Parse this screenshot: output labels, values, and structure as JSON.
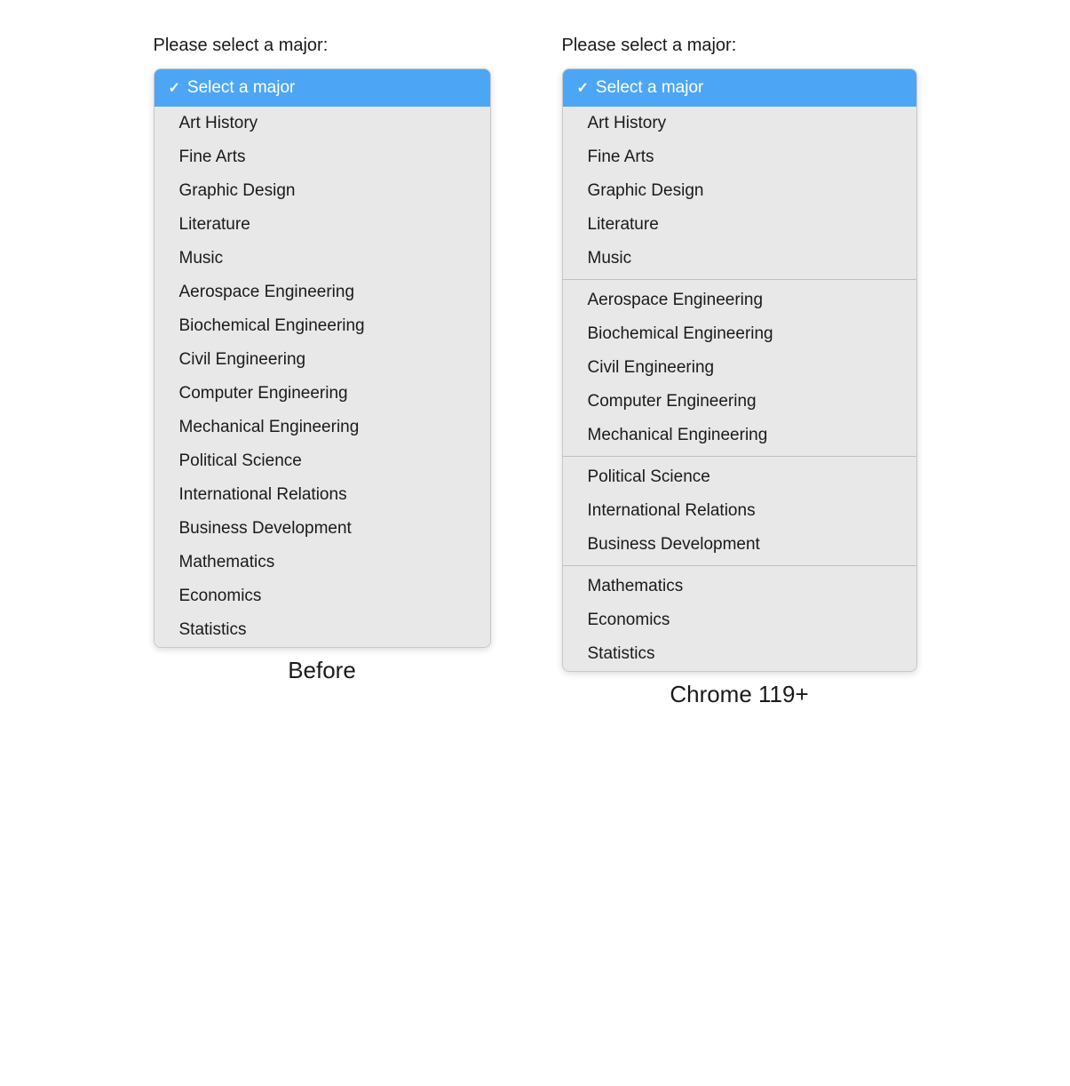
{
  "left": {
    "prompt": "Please select a major:",
    "caption": "Before",
    "selected_label": "Select a major",
    "options": [
      {
        "label": "Art History",
        "type": "option"
      },
      {
        "label": "Fine Arts",
        "type": "option"
      },
      {
        "label": "Graphic Design",
        "type": "option"
      },
      {
        "label": "Literature",
        "type": "option"
      },
      {
        "label": "Music",
        "type": "option"
      },
      {
        "label": "Aerospace Engineering",
        "type": "option"
      },
      {
        "label": "Biochemical Engineering",
        "type": "option"
      },
      {
        "label": "Civil Engineering",
        "type": "option"
      },
      {
        "label": "Computer Engineering",
        "type": "option"
      },
      {
        "label": "Mechanical Engineering",
        "type": "option"
      },
      {
        "label": "Political Science",
        "type": "option"
      },
      {
        "label": "International Relations",
        "type": "option"
      },
      {
        "label": "Business Development",
        "type": "option"
      },
      {
        "label": "Mathematics",
        "type": "option"
      },
      {
        "label": "Economics",
        "type": "option"
      },
      {
        "label": "Statistics",
        "type": "option"
      }
    ]
  },
  "right": {
    "prompt": "Please select a major:",
    "caption": "Chrome 119+",
    "selected_label": "Select a major",
    "groups": [
      {
        "options": [
          {
            "label": "Art History"
          },
          {
            "label": "Fine Arts"
          },
          {
            "label": "Graphic Design"
          },
          {
            "label": "Literature"
          },
          {
            "label": "Music"
          }
        ]
      },
      {
        "options": [
          {
            "label": "Aerospace Engineering"
          },
          {
            "label": "Biochemical Engineering"
          },
          {
            "label": "Civil Engineering"
          },
          {
            "label": "Computer Engineering"
          },
          {
            "label": "Mechanical Engineering"
          }
        ]
      },
      {
        "options": [
          {
            "label": "Political Science"
          },
          {
            "label": "International Relations"
          },
          {
            "label": "Business Development"
          }
        ]
      },
      {
        "options": [
          {
            "label": "Mathematics"
          },
          {
            "label": "Economics"
          },
          {
            "label": "Statistics"
          }
        ]
      }
    ]
  },
  "colors": {
    "selected_bg": "#4da6f5",
    "selected_text": "#ffffff",
    "dropdown_bg": "#e8e8e8"
  }
}
